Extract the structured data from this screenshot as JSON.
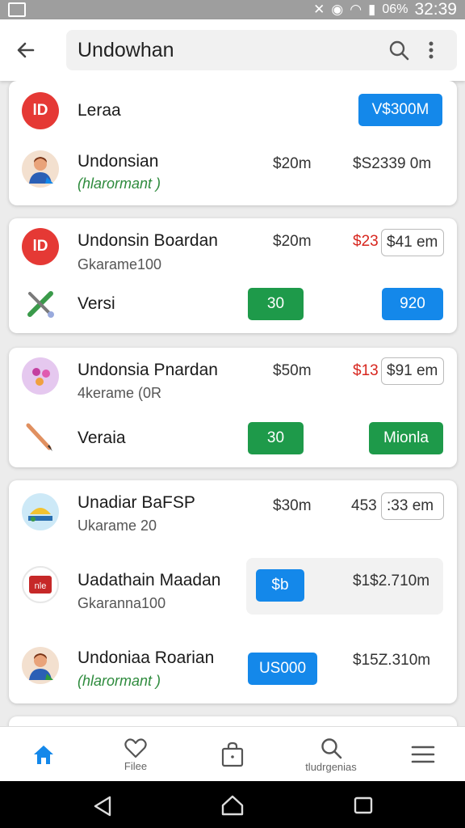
{
  "status_bar": {
    "battery": "06%",
    "time": "32:39"
  },
  "search": {
    "query": "Undowhan"
  },
  "cards": [
    {
      "header": {
        "title": "Leraa",
        "button": "V$300M"
      },
      "row": {
        "title": "Undonsian",
        "subtitle": "(hlarormant )",
        "price1": "$20m",
        "price2": "$S2339 0m"
      }
    },
    {
      "row1": {
        "title": "Undonsin Boardan",
        "subtitle": "Gkarame100",
        "price1": "$20m",
        "price_red": "$23",
        "price_boxed": "$41 em"
      },
      "row2": {
        "title": "Versi",
        "button_green": "30",
        "button_blue": "920"
      }
    },
    {
      "row1": {
        "title": "Undonsia Pnardan",
        "subtitle": "4kerame (0R",
        "price1": "$50m",
        "price_red": "$13",
        "price_boxed": "$91 em"
      },
      "row2": {
        "title": "Veraia",
        "button_green": "30",
        "button_green2": "Mionla"
      }
    },
    {
      "row1": {
        "title": "Unadiar BaFSP",
        "subtitle": "Ukarame 20",
        "price1": "$30m",
        "price_plain": "453",
        "price_boxed": ":33 em"
      },
      "row2": {
        "title": "Uadathain Maadan",
        "subtitle": "Gkaranna100",
        "button_blue": "$b",
        "price": "$1$2.710m"
      },
      "row3": {
        "title": "Undoniaa Roarian",
        "subtitle": "(hlarormant )",
        "button_blue": "US000",
        "price": "$15Z.310m"
      }
    }
  ],
  "bottom_nav": {
    "filee": "Filee",
    "search": "tludrgenias"
  },
  "colors": {
    "blue": "#1488ea",
    "green": "#1e9a4a",
    "red": "#d7261e"
  }
}
